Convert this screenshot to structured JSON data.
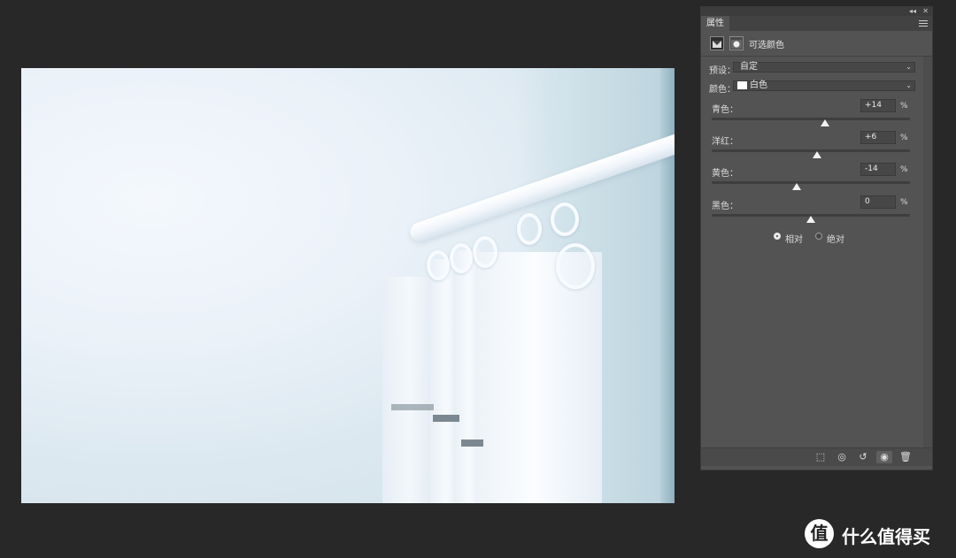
{
  "panel": {
    "tab_label": "属性",
    "collapse_glyph": "◂◂",
    "close_glyph": "✕",
    "adjustment_title": "可选颜色",
    "preset_label": "预设：",
    "preset_value": "自定",
    "color_label": "颜色：",
    "color_value": "白色",
    "color_swatch": "#ffffff",
    "sliders": [
      {
        "label": "青色：",
        "value": "+14",
        "unit": "%",
        "level": 14
      },
      {
        "label": "洋红：",
        "value": "+6",
        "unit": "%",
        "level": 6
      },
      {
        "label": "黄色：",
        "value": "-14",
        "unit": "%",
        "level": -14
      },
      {
        "label": "黑色：",
        "value": "0",
        "unit": "%",
        "level": 0
      }
    ],
    "method": {
      "relative_label": "相对",
      "absolute_label": "绝对",
      "selected": "relative"
    },
    "bottom_icons": [
      "clip-to-layer-icon",
      "view-previous-state-icon",
      "reset-icon",
      "visibility-eye-icon",
      "trash-icon"
    ]
  },
  "watermark": {
    "badge": "值",
    "text": "什么值得买"
  },
  "colors": {
    "app_background": "#282828",
    "panel_background": "#535353"
  }
}
